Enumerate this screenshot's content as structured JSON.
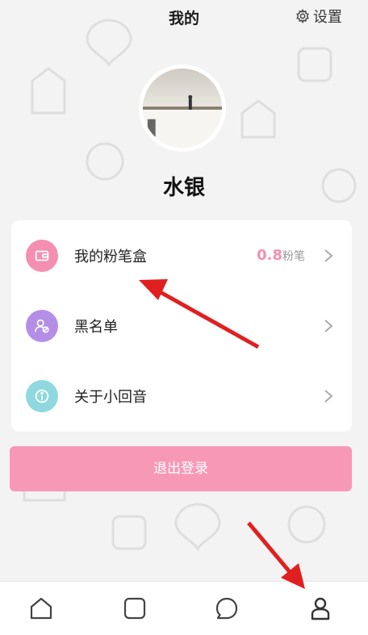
{
  "header": {
    "title": "我的",
    "settings_label": "设置",
    "settings_icon": "gear-icon"
  },
  "profile": {
    "username": "水银"
  },
  "menu": {
    "items": [
      {
        "label": "我的粉笔盒",
        "value_number": "0.8",
        "value_unit": "粉笔",
        "icon": "wallet-icon",
        "icon_color": "#f48fb1"
      },
      {
        "label": "黑名单",
        "icon": "blocked-user-icon",
        "icon_color": "#b48ee6"
      },
      {
        "label": "关于小回音",
        "icon": "info-icon",
        "icon_color": "#8fd8df"
      }
    ]
  },
  "logout": {
    "label": "退出登录",
    "color": "#f898b7"
  },
  "tabbar": {
    "tabs": [
      "home-icon",
      "square-icon",
      "chat-icon",
      "profile-icon"
    ]
  },
  "colors": {
    "accent": "#f48fb1",
    "annotation_arrow": "#e02020"
  }
}
